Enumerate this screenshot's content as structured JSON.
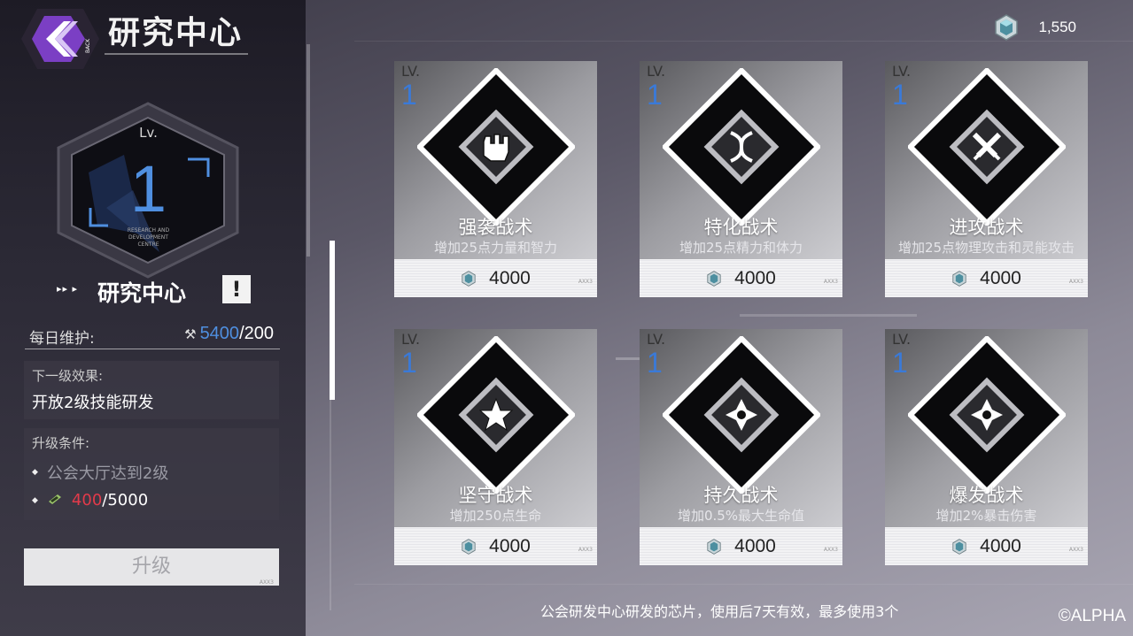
{
  "header": {
    "title": "研究中心",
    "back_label": "BACK"
  },
  "currency": {
    "icon": "crystal-icon",
    "value": "1,550"
  },
  "center": {
    "level_label": "Lv.",
    "level": "1",
    "subtitle": "RESEARCH AND DEVELOPMENT CENTRE",
    "name": "研究中心",
    "alert": "!"
  },
  "maintenance": {
    "label": "每日维护:",
    "current": "5400",
    "max": "/200"
  },
  "next_effect": {
    "label": "下一级效果:",
    "value": "开放2级技能研发"
  },
  "conditions": {
    "label": "升级条件:",
    "items": [
      {
        "text": "公会大厅达到2级"
      },
      {
        "current": "400",
        "required": "/5000"
      }
    ]
  },
  "upgrade_button": {
    "label": "升级",
    "tag": "AXX3"
  },
  "cards": [
    {
      "lv_label": "LV.",
      "level": "1",
      "name": "强袭战术",
      "desc": "增加25点力量和智力",
      "price": "4000",
      "icon": "fist-icon"
    },
    {
      "lv_label": "LV.",
      "level": "1",
      "name": "特化战术",
      "desc": "增加25点精力和体力",
      "price": "4000",
      "icon": "dna-icon"
    },
    {
      "lv_label": "LV.",
      "level": "1",
      "name": "进攻战术",
      "desc": "增加25点物理攻击和灵能攻击",
      "price": "4000",
      "icon": "crossed-swords-icon"
    },
    {
      "lv_label": "LV.",
      "level": "1",
      "name": "坚守战术",
      "desc": "增加250点生命",
      "price": "4000",
      "icon": "star-shield-icon"
    },
    {
      "lv_label": "LV.",
      "level": "1",
      "name": "持久战术",
      "desc": "增加0.5%最大生命值",
      "price": "4000",
      "icon": "cross-burst-icon"
    },
    {
      "lv_label": "LV.",
      "level": "1",
      "name": "爆发战术",
      "desc": "增加2%暴击伤害",
      "price": "4000",
      "icon": "cross-burst-icon"
    }
  ],
  "footer": {
    "note": "公会研发中心研发的芯片，使用后7天有效，最多使用3个",
    "copyright": "©ALPHA"
  },
  "colors": {
    "accent_blue": "#4f8fe0",
    "alert_red": "#e23a4a",
    "back_purple": "#7b3fc4"
  }
}
